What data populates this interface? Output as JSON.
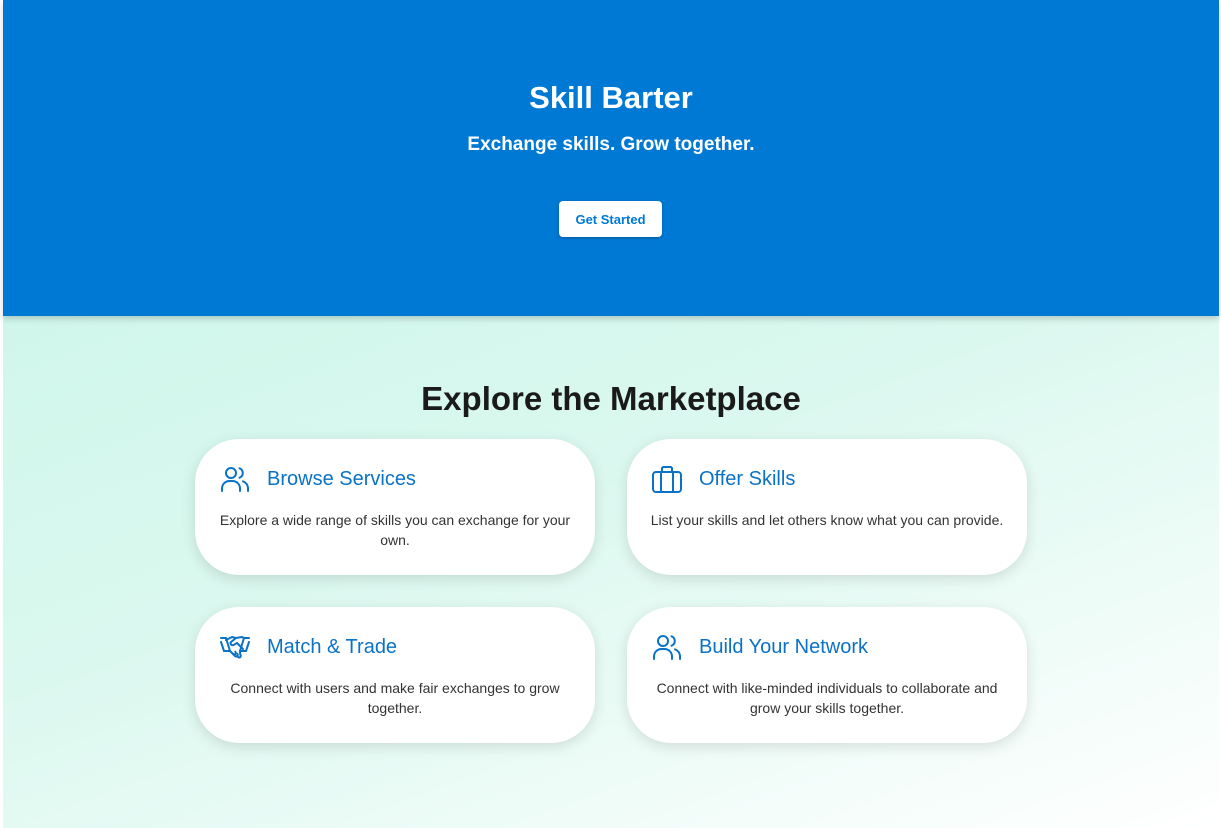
{
  "hero": {
    "title": "Skill Barter",
    "tagline": "Exchange skills. Grow together.",
    "cta_label": "Get Started"
  },
  "marketplace": {
    "heading": "Explore the Marketplace",
    "cards": [
      {
        "icon": "users-icon",
        "title": "Browse Services",
        "description": "Explore a wide range of skills you can exchange for your own."
      },
      {
        "icon": "briefcase-icon",
        "title": "Offer Skills",
        "description": "List your skills and let others know what you can provide."
      },
      {
        "icon": "handshake-icon",
        "title": "Match & Trade",
        "description": "Connect with users and make fair exchanges to grow together."
      },
      {
        "icon": "users-icon",
        "title": "Build Your Network",
        "description": "Connect with like-minded individuals to collaborate and grow your skills together."
      }
    ]
  },
  "colors": {
    "primary": "#0079d4",
    "card_title": "#0a72c7",
    "background_start": "#c6f5e8",
    "background_end": "#ffffff"
  }
}
